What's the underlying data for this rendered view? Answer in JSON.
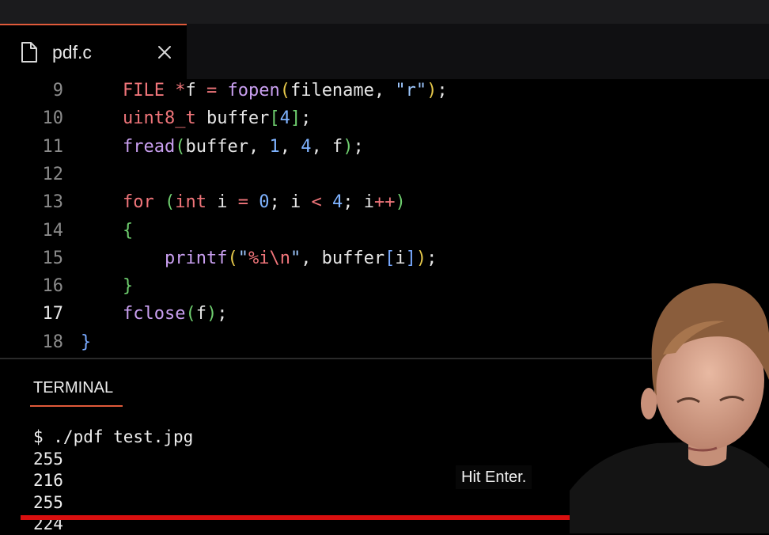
{
  "tab": {
    "filename": "pdf.c"
  },
  "editor": {
    "lines": [
      {
        "number": "9",
        "active": false,
        "tokens": [
          {
            "t": "    "
          },
          {
            "t": "FILE",
            "c": "c-type"
          },
          {
            "t": " "
          },
          {
            "t": "*",
            "c": "c-op"
          },
          {
            "t": "f "
          },
          {
            "t": "=",
            "c": "c-op"
          },
          {
            "t": " "
          },
          {
            "t": "fopen",
            "c": "c-fn"
          },
          {
            "t": "(",
            "c": "c-p1"
          },
          {
            "t": "filename, "
          },
          {
            "t": "\"r\"",
            "c": "c-str"
          },
          {
            "t": ")",
            "c": "c-p1"
          },
          {
            "t": ";"
          }
        ]
      },
      {
        "number": "10",
        "active": false,
        "tokens": [
          {
            "t": "    "
          },
          {
            "t": "uint8_t",
            "c": "c-type"
          },
          {
            "t": " buffer"
          },
          {
            "t": "[",
            "c": "c-p2"
          },
          {
            "t": "4",
            "c": "c-num"
          },
          {
            "t": "]",
            "c": "c-p2"
          },
          {
            "t": ";"
          }
        ]
      },
      {
        "number": "11",
        "active": false,
        "tokens": [
          {
            "t": "    "
          },
          {
            "t": "fread",
            "c": "c-fn"
          },
          {
            "t": "(",
            "c": "c-p2"
          },
          {
            "t": "buffer, "
          },
          {
            "t": "1",
            "c": "c-num"
          },
          {
            "t": ", "
          },
          {
            "t": "4",
            "c": "c-num"
          },
          {
            "t": ", f"
          },
          {
            "t": ")",
            "c": "c-p2"
          },
          {
            "t": ";"
          }
        ]
      },
      {
        "number": "12",
        "active": false,
        "tokens": []
      },
      {
        "number": "13",
        "active": false,
        "tokens": [
          {
            "t": "    "
          },
          {
            "t": "for",
            "c": "c-kw"
          },
          {
            "t": " "
          },
          {
            "t": "(",
            "c": "c-p2"
          },
          {
            "t": "int",
            "c": "c-type"
          },
          {
            "t": " i "
          },
          {
            "t": "=",
            "c": "c-op"
          },
          {
            "t": " "
          },
          {
            "t": "0",
            "c": "c-num"
          },
          {
            "t": "; i "
          },
          {
            "t": "<",
            "c": "c-op"
          },
          {
            "t": " "
          },
          {
            "t": "4",
            "c": "c-num"
          },
          {
            "t": "; i"
          },
          {
            "t": "++",
            "c": "c-op"
          },
          {
            "t": ")",
            "c": "c-p2"
          }
        ]
      },
      {
        "number": "14",
        "active": false,
        "tokens": [
          {
            "t": "    "
          },
          {
            "t": "{",
            "c": "c-p2"
          }
        ]
      },
      {
        "number": "15",
        "active": false,
        "tokens": [
          {
            "t": "        "
          },
          {
            "t": "printf",
            "c": "c-fn"
          },
          {
            "t": "(",
            "c": "c-p1"
          },
          {
            "t": "\"",
            "c": "c-str"
          },
          {
            "t": "%i\\n",
            "c": "c-esc"
          },
          {
            "t": "\"",
            "c": "c-str"
          },
          {
            "t": ", buffer"
          },
          {
            "t": "[",
            "c": "c-p3"
          },
          {
            "t": "i"
          },
          {
            "t": "]",
            "c": "c-p3"
          },
          {
            "t": ")",
            "c": "c-p1"
          },
          {
            "t": ";"
          }
        ]
      },
      {
        "number": "16",
        "active": false,
        "tokens": [
          {
            "t": "    "
          },
          {
            "t": "}",
            "c": "c-p2"
          }
        ]
      },
      {
        "number": "17",
        "active": true,
        "tokens": [
          {
            "t": "    "
          },
          {
            "t": "fclose",
            "c": "c-fn"
          },
          {
            "t": "(",
            "c": "c-p2"
          },
          {
            "t": "f"
          },
          {
            "t": ")",
            "c": "c-p2"
          },
          {
            "t": ";"
          }
        ]
      },
      {
        "number": "18",
        "active": false,
        "tokens": [
          {
            "t": "}",
            "c": "c-p3"
          }
        ]
      }
    ]
  },
  "terminal": {
    "tab_label": "TERMINAL",
    "lines": [
      "$ ./pdf test.jpg",
      "255",
      "216",
      "255",
      "224"
    ]
  },
  "caption": {
    "text": "Hit Enter."
  },
  "colors": {
    "accent": "#e05a3a",
    "progress": "#d90f0f",
    "background": "#000000"
  },
  "icons": {
    "tab_file": "file-icon",
    "tab_close": "close-icon"
  }
}
